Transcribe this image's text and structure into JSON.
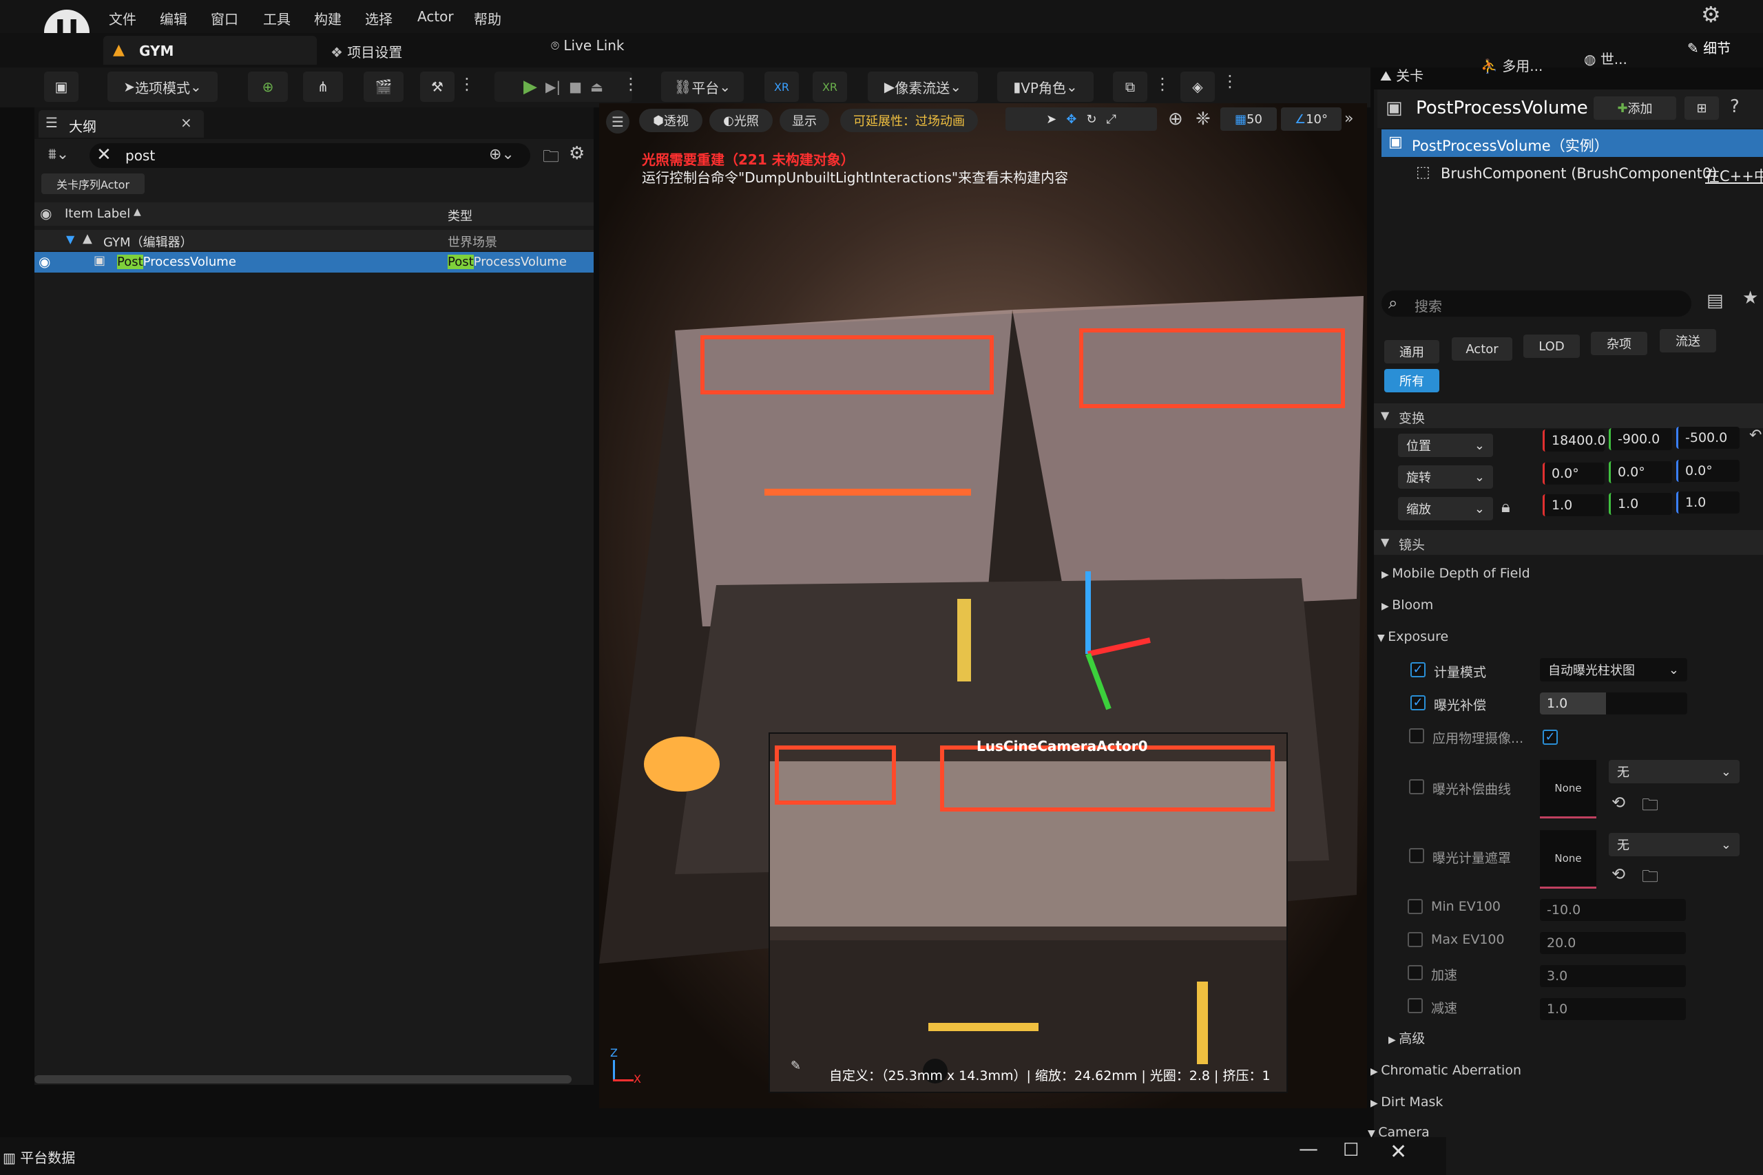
{
  "menu": {
    "items": [
      "文件",
      "编辑",
      "窗口",
      "工具",
      "构建",
      "选择",
      "Actor",
      "帮助"
    ]
  },
  "tabs": {
    "level": "GYM",
    "project_settings": "项目设置",
    "live_link": "Live Link"
  },
  "toolbar": {
    "select_mode": "选项模式",
    "platform": "平台",
    "pixel_stream": "像素流送",
    "vp_role": "VP角色"
  },
  "outliner": {
    "title": "大纲",
    "search_value": "post",
    "level_sequence_btn": "关卡序列Actor",
    "col_label": "Item Label",
    "col_type": "类型",
    "rows": [
      {
        "label": "GYM（编辑器）",
        "type": "世界场景"
      },
      {
        "label_highlight": "Post",
        "label_rest": "ProcessVolume",
        "type_highlight": "Post",
        "type_rest": "ProcessVolume"
      }
    ]
  },
  "viewport": {
    "btn_perspective": "透视",
    "btn_lighting": "光照",
    "btn_show": "显示",
    "scalability": "可延展性：过场动画",
    "grid_size": "50",
    "angle": "10°",
    "warning_1": "光照需要重建（221 未构建对象）",
    "warning_2": "运行控制台命令\"DumpUnbuiltLightInteractions\"来查看未构建内容",
    "pip_title": "LusCineCameraActor0",
    "pip_info": "自定义：（25.3mm x 14.3mm）| 缩放：24.62mm | 光圈：2.8 | 挤压：1",
    "axis_z": "Z",
    "axis_x": "X"
  },
  "details": {
    "tab_level": "关卡",
    "tab_multi": "多用...",
    "tab_world": "世...",
    "tab_details": "细节",
    "actor_name": "PostProcessVolume",
    "add_btn": "添加",
    "comp_instance": "PostProcessVolume（实例）",
    "comp_brush": "BrushComponent (BrushComponent0)",
    "comp_cpp": "在C++中",
    "search_placeholder": "搜索",
    "filters": [
      "通用",
      "Actor",
      "LOD",
      "杂项",
      "流送",
      "所有"
    ],
    "transform": {
      "title": "变换",
      "location_label": "位置",
      "rotation_label": "旋转",
      "scale_label": "缩放",
      "location": [
        "18400.0",
        "-900.0",
        "-500.0"
      ],
      "rotation": [
        "0.0°",
        "0.0°",
        "0.0°"
      ],
      "scale": [
        "1.0",
        "1.0",
        "1.0"
      ]
    },
    "lens_title": "镜头",
    "mobile_dof": "Mobile Depth of Field",
    "bloom": "Bloom",
    "exposure": {
      "title": "Exposure",
      "metering_label": "计量模式",
      "metering_value": "自动曝光柱状图",
      "compensation_label": "曝光补偿",
      "compensation_value": "1.0",
      "compensation_fill": 0.45,
      "physical_camera_label": "应用物理摄像...",
      "curve_label": "曝光补偿曲线",
      "curve_thumb": "None",
      "curve_value": "无",
      "mask_label": "曝光计量遮罩",
      "mask_thumb": "None",
      "mask_value": "无",
      "min_ev_label": "Min EV100",
      "min_ev": "-10.0",
      "max_ev_label": "Max EV100",
      "max_ev": "20.0",
      "speed_up_label": "加速",
      "speed_up": "3.0",
      "speed_down_label": "减速",
      "speed_down": "1.0",
      "advanced": "高级"
    },
    "chromatic": "Chromatic Aberration",
    "dirt_mask": "Dirt Mask",
    "camera": "Camera"
  },
  "taskbar": {
    "platform_data": "平台数据"
  },
  "colors": {
    "accent": "#2a8fd6",
    "highlight": "#7fd13b",
    "warning": "#ff3030",
    "play": "#6ab04c"
  }
}
